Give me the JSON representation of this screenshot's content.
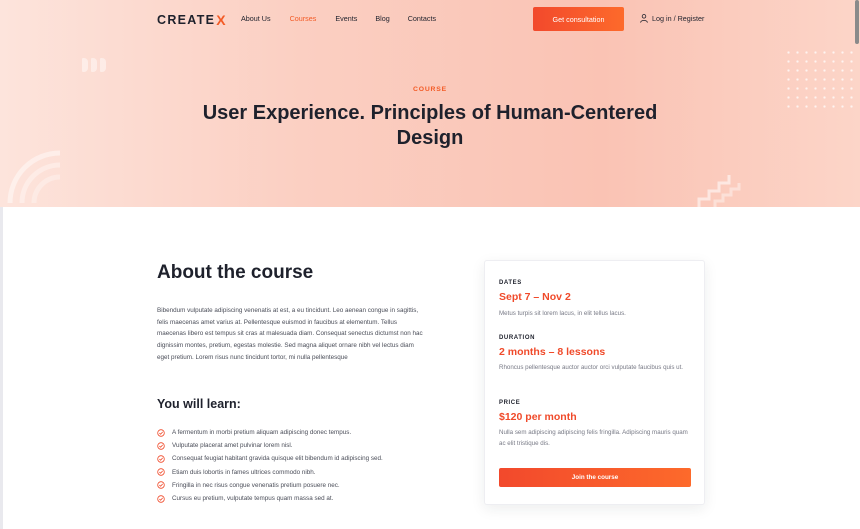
{
  "header": {
    "logo_text": "CREATE",
    "logo_mark": "X",
    "nav": [
      "About Us",
      "Courses",
      "Events",
      "Blog",
      "Contacts"
    ],
    "active_nav": "Courses",
    "cta_label": "Get consultation",
    "login_label": "Log in / Register",
    "login_icon": "user-icon"
  },
  "hero": {
    "kicker": "COURSE",
    "title": "User Experience. Principles of Human-Centered Design"
  },
  "about": {
    "title": "About the course",
    "text": "Bibendum vulputate adipiscing venenatis at est, a eu tincidunt. Leo aenean congue in sagittis, felis maecenas amet varius at. Pellentesque euismod in faucibus at elementum. Tellus maecenas libero est tempus sit cras at malesuada diam. Consequat senectus dictumst non hac dignissim montes, pretium, egestas molestie. Sed magna aliquet ornare nibh vel lectus diam eget pretium. Lorem risus nunc tincidunt tortor, mi nulla pellentesque"
  },
  "learn": {
    "title": "You will learn:",
    "items": [
      "A fermentum in morbi pretium aliquam adipiscing donec tempus.",
      "Vulputate placerat amet pulvinar lorem nisl.",
      "Consequat feugiat habitant gravida quisque elit bibendum id adipiscing sed.",
      "Etiam duis lobortis in fames ultrices commodo nibh.",
      "Fringilla in nec risus congue venenatis pretium posuere nec.",
      "Cursus eu pretium, vulputate tempus quam massa sed at."
    ]
  },
  "card": {
    "dates_label": "DATES",
    "dates_value": "Sept 7 – Nov 2",
    "dates_desc": "Metus turpis sit lorem lacus, in elit tellus lacus.",
    "duration_label": "DURATION",
    "duration_value": "2 months – 8 lessons",
    "duration_desc": "Rhoncus pellentesque auctor auctor orci vulputate faucibus quis ut.",
    "price_label": "PRICE",
    "price_value": "$120 per month",
    "price_desc": "Nulla sem adipiscing adipiscing felis fringilla. Adipiscing mauris quam ac elit tristique dis.",
    "join_label": "Join the course"
  },
  "colors": {
    "accent": "#f35b26",
    "accent_dark": "#f04a2a",
    "text": "#1e212c",
    "hero_bg": "#fbcfc2"
  }
}
